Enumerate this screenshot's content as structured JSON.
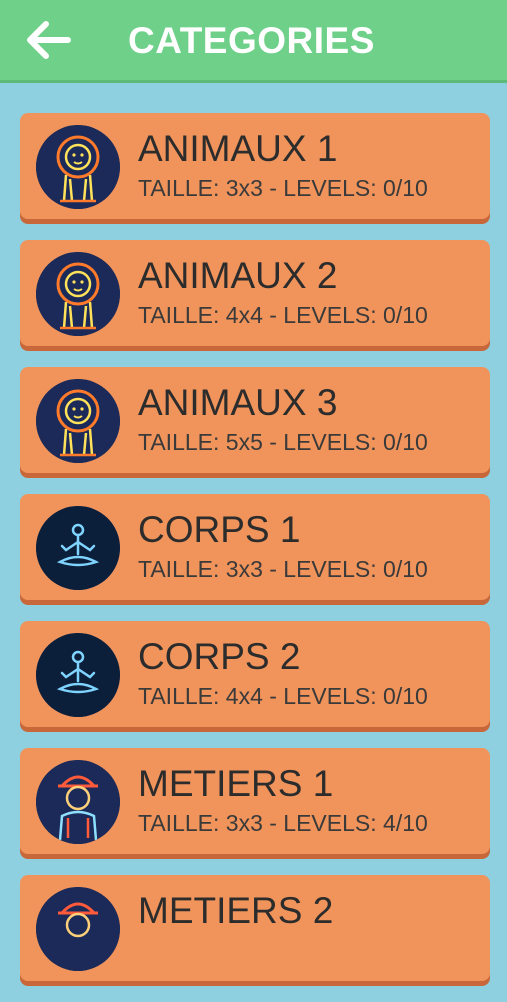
{
  "header": {
    "title": "CATEGORIES",
    "back_icon": "arrow-left-icon",
    "background": "#6fd08a"
  },
  "colors": {
    "page_background": "#8ecfe0",
    "card": "#f0945c",
    "card_shadow": "#c8683a"
  },
  "categories": [
    {
      "name": "ANIMAUX 1",
      "info": "TAILLE: 3x3 - LEVELS: 0/10",
      "icon": "neon-lion-icon"
    },
    {
      "name": "ANIMAUX 2",
      "info": "TAILLE: 4x4 - LEVELS: 0/10",
      "icon": "neon-lion-icon"
    },
    {
      "name": "ANIMAUX 3",
      "info": "TAILLE: 5x5 - LEVELS: 0/10",
      "icon": "neon-lion-icon"
    },
    {
      "name": "CORPS 1",
      "info": "TAILLE: 3x3 - LEVELS: 0/10",
      "icon": "neon-meditation-icon"
    },
    {
      "name": "CORPS 2",
      "info": "TAILLE: 4x4 - LEVELS: 0/10",
      "icon": "neon-meditation-icon"
    },
    {
      "name": "METIERS 1",
      "info": "TAILLE: 3x3 - LEVELS: 4/10",
      "icon": "neon-worker-icon"
    },
    {
      "name": "METIERS 2",
      "info": "",
      "icon": "neon-worker-icon"
    }
  ]
}
